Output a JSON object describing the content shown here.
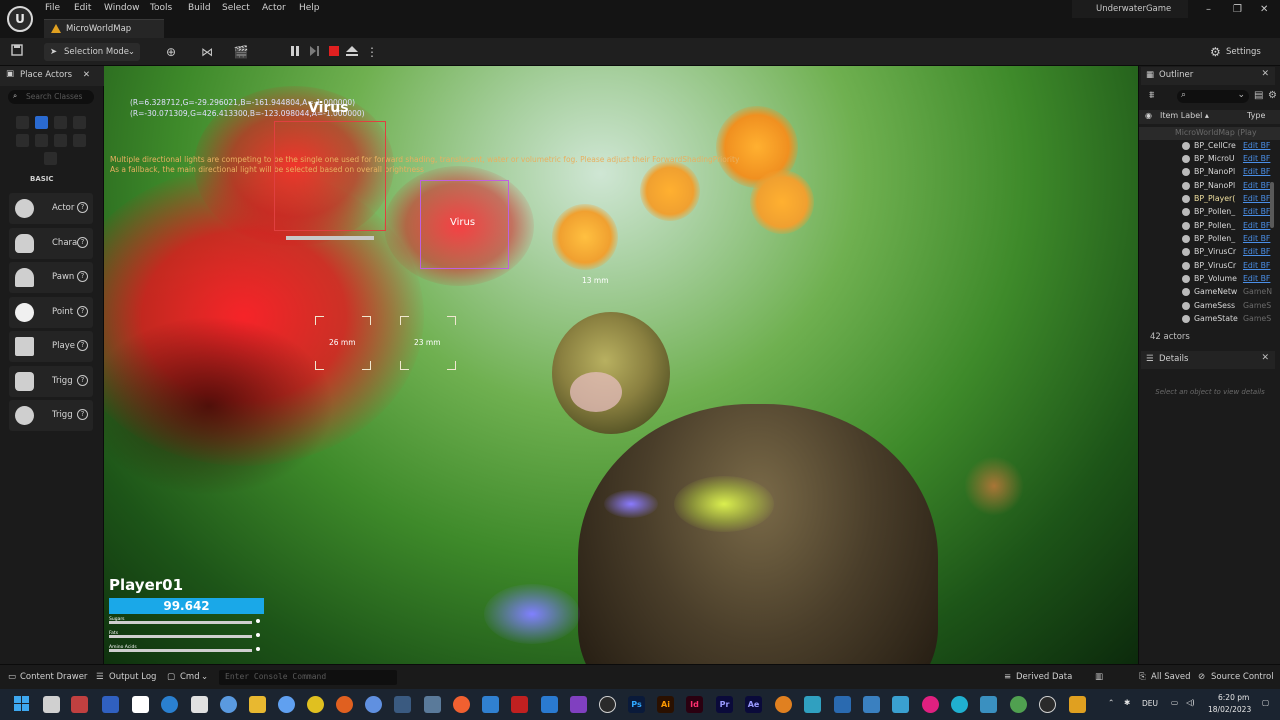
{
  "app": {
    "logo": "U",
    "menu": [
      "File",
      "Edit",
      "Window",
      "Tools",
      "Build",
      "Select",
      "Actor",
      "Help"
    ],
    "tab_title": "MicroWorldMap",
    "project_name": "UnderwaterGame",
    "window_controls": [
      "–",
      "❐",
      "✕"
    ]
  },
  "toolbar": {
    "mode_label": "Selection Mode",
    "settings_label": "Settings",
    "pause_icon": "pause-icon",
    "step_icon": "step-icon",
    "stop_icon": "stop-icon",
    "eject_icon": "eject-icon"
  },
  "place_actors": {
    "title": "Place Actors",
    "close": "✕",
    "search_placeholder": "Search Classes",
    "category_label": "BASIC",
    "items": [
      {
        "label": "Actor",
        "help": "?"
      },
      {
        "label": "Chara",
        "help": "?"
      },
      {
        "label": "Pawn",
        "help": "?"
      },
      {
        "label": "Point",
        "help": "?"
      },
      {
        "label": "Playe",
        "help": "?"
      },
      {
        "label": "Trigg",
        "help": "?"
      },
      {
        "label": "Trigg",
        "help": "?"
      }
    ]
  },
  "viewport": {
    "debug_line1": "(R=6.328712,G=-29.296021,B=-161.944804,A=-1.000000)",
    "debug_line2": "(R=-30.071309,G=426.413300,B=-123.098044,A=-1.000000)",
    "warn_line1": "Multiple directional lights are competing to be the single one used for forward shading, translucent, water or volumetric fog. Please adjust their ForwardShadingPriority",
    "warn_line2": "As a fallback, the main directional light will be selected based on overall brightness",
    "target_top_label": "Virus",
    "target_mid_label": "Virus",
    "dist_1": "13 mm",
    "dist_2": "26 mm",
    "dist_3": "23 mm",
    "hud": {
      "player_name": "Player01",
      "health_value": "99.642",
      "stats": [
        "Sugars",
        "Fats",
        "Amino Acids"
      ]
    }
  },
  "outliner": {
    "title": "Outliner",
    "close": "✕",
    "col_label": "Item Label ▴",
    "col_type": "Type",
    "root": "MicroWorldMap (Play",
    "rows": [
      {
        "name": "BP_CellCre",
        "type": "Edit BF"
      },
      {
        "name": "BP_MicroU",
        "type": "Edit BF"
      },
      {
        "name": "BP_NanoPl",
        "type": "Edit BF"
      },
      {
        "name": "BP_NanoPl",
        "type": "Edit BF"
      },
      {
        "name": "BP_Player(",
        "type": "Edit BF"
      },
      {
        "name": "BP_Pollen_",
        "type": "Edit BF"
      },
      {
        "name": "BP_Pollen_",
        "type": "Edit BF"
      },
      {
        "name": "BP_Pollen_",
        "type": "Edit BF"
      },
      {
        "name": "BP_VirusCr",
        "type": "Edit BF"
      },
      {
        "name": "BP_VirusCr",
        "type": "Edit BF"
      },
      {
        "name": "BP_Volume",
        "type": "Edit BF"
      },
      {
        "name": "GameNetw",
        "type": "GameN"
      },
      {
        "name": "GameSess",
        "type": "GameS"
      },
      {
        "name": "GameState",
        "type": "GameS"
      }
    ],
    "count": "42 actors"
  },
  "details": {
    "title": "Details",
    "close": "✕",
    "empty_message": "Select an object to view details"
  },
  "bottom_bar": {
    "content_drawer": "Content Drawer",
    "output_log": "Output Log",
    "cmd": "Cmd",
    "console_placeholder": "Enter Console Command",
    "derived_data": "Derived Data",
    "all_saved": "All Saved",
    "source_control": "Source Control"
  },
  "taskbar": {
    "lang": "DEU",
    "time": "6:20 pm",
    "date": "18/02/2023",
    "apps": [
      "Ps",
      "Ai",
      "Id",
      "Pr",
      "Ae"
    ]
  }
}
